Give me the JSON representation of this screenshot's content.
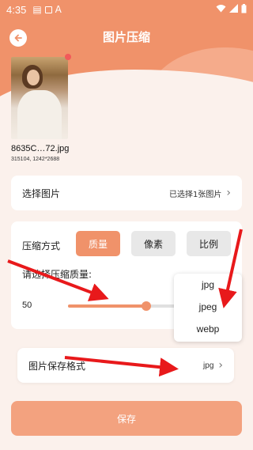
{
  "status_bar": {
    "time": "4:35"
  },
  "header": {
    "title": "图片压缩"
  },
  "image": {
    "filename": "8635C…72.jpg",
    "info": "315104, 1242*2688"
  },
  "select_image": {
    "label": "选择图片",
    "value": "已选择1张图片"
  },
  "compression": {
    "method_label": "压缩方式",
    "methods": [
      "质量",
      "像素",
      "比例"
    ],
    "selected_method": "质量",
    "quality_label": "请选择压缩质量:",
    "quality_value": "50",
    "quality_fraction": 0.48
  },
  "format_dropdown": {
    "options": [
      "jpg",
      "jpeg",
      "webp"
    ]
  },
  "save_format": {
    "label": "图片保存格式",
    "value": "jpg"
  },
  "save_button": {
    "label": "保存"
  },
  "colors": {
    "accent": "#f0926a",
    "background": "#fbf1ec",
    "annotation_arrow": "#e8191b"
  }
}
